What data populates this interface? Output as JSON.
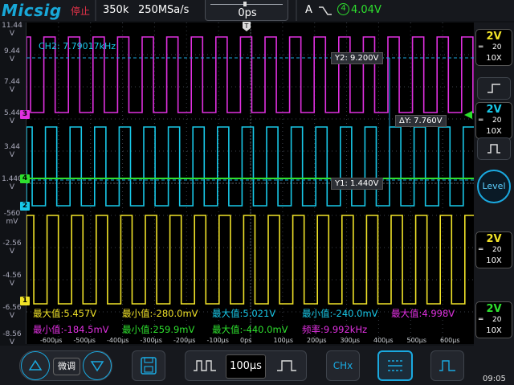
{
  "topbar": {
    "logo": "Micsig",
    "run_state": "停止",
    "memory_depth": "350k",
    "sample_rate": "250MSa/s",
    "horizontal_position": "0ps",
    "trigger_mode": "A",
    "trigger_channel": "4",
    "trigger_level": "4.04V"
  },
  "screen": {
    "frequency_readout": "CH2: 7.79017kHz",
    "cursor_y2": "Y2: 9.200V",
    "cursor_dy": "ΔY: 7.760V",
    "cursor_y1": "Y1: 1.440V",
    "y_labels": [
      "11.44 V",
      "9.44 V",
      "7.44 V",
      "5.44 V",
      "3.44 V",
      "1.440 V",
      "-560 mV",
      "-2.56 V",
      "-4.56 V",
      "-6.56 V",
      "-8.56 V"
    ],
    "channel_markers": [
      "3",
      "2",
      "4",
      "1"
    ],
    "time_labels": [
      "-600µs",
      "-500µs",
      "-400µs",
      "-300µs",
      "-200µs",
      "-100µs",
      "0ps",
      "100µs",
      "200µs",
      "300µs",
      "400µs",
      "500µs",
      "600µs"
    ]
  },
  "measurements": {
    "row1": [
      {
        "text": "最大值:5.457V",
        "color": "#f0e228"
      },
      {
        "text": "最小值:-280.0mV",
        "color": "#f0e228"
      },
      {
        "text": "最大值:5.021V",
        "color": "#18c8e8"
      },
      {
        "text": "最小值:-240.0mV",
        "color": "#18c8e8"
      },
      {
        "text": "最大值:4.998V",
        "color": "#e030e0"
      }
    ],
    "row2": [
      {
        "text": "最小值:-184.5mV",
        "color": "#e030e0"
      },
      {
        "text": "最小值:259.9mV",
        "color": "#2ee02e"
      },
      {
        "text": "最大值:-440.0mV",
        "color": "#2ee02e"
      },
      {
        "text": "频率:9.992kHz",
        "color": "#e030e0"
      }
    ]
  },
  "channels": [
    {
      "id": "1",
      "volts": "2V",
      "bandwidth": "20",
      "probe": "10X",
      "color": "#f0e228"
    },
    {
      "id": "2",
      "volts": "2V",
      "bandwidth": "20",
      "probe": "10X",
      "color": "#18c8e8"
    },
    {
      "id": "3",
      "volts": "2V",
      "bandwidth": "20",
      "probe": "10X",
      "color": "#e030e0"
    },
    {
      "id": "4",
      "volts": "2V",
      "bandwidth": "20",
      "probe": "10X",
      "color": "#2ee02e"
    }
  ],
  "rpanel": {
    "level_label": "Level"
  },
  "bottom": {
    "fine_label": "微调",
    "timebase": "100µs",
    "chx_label": "CHx"
  },
  "status": {
    "time": "09:05"
  },
  "icons": {
    "up": "triangle-up-icon",
    "down": "triangle-down-icon",
    "save": "save-icon",
    "pulse_wide": "pulse-wide-icon",
    "pulse_narrow": "pulse-narrow-icon",
    "menu": "menu-icon",
    "rising_edge": "rising-edge-icon",
    "falling_edge": "falling-edge-icon"
  }
}
